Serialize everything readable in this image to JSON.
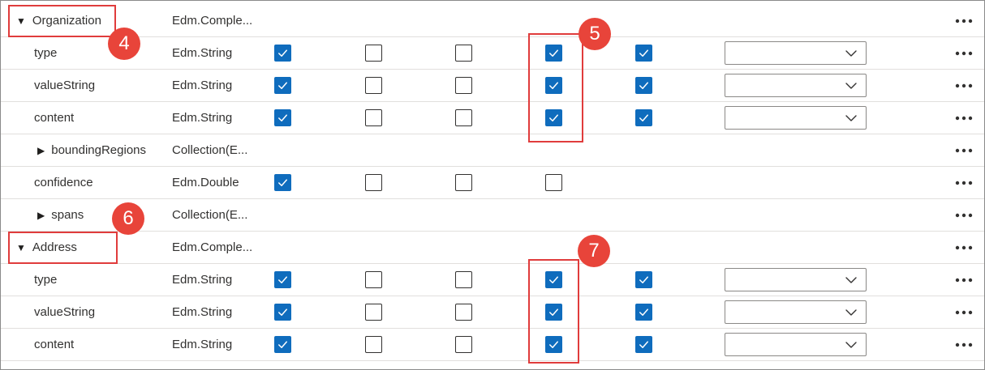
{
  "rows": [
    {
      "name": "Organization",
      "type": "Edm.Comple...",
      "kind": "expanded",
      "indent": 0,
      "checks": null,
      "dropdown": null
    },
    {
      "name": "type",
      "type": "Edm.String",
      "kind": "leaf",
      "indent": 1,
      "checks": [
        true,
        false,
        false,
        true,
        true
      ],
      "dropdown": ""
    },
    {
      "name": "valueString",
      "type": "Edm.String",
      "kind": "leaf",
      "indent": 1,
      "checks": [
        true,
        false,
        false,
        true,
        true
      ],
      "dropdown": ""
    },
    {
      "name": "content",
      "type": "Edm.String",
      "kind": "leaf",
      "indent": 1,
      "checks": [
        true,
        false,
        false,
        true,
        true
      ],
      "dropdown": ""
    },
    {
      "name": "boundingRegions",
      "type": "Collection(E...",
      "kind": "collapsed",
      "indent": 1,
      "checks": null,
      "dropdown": null
    },
    {
      "name": "confidence",
      "type": "Edm.Double",
      "kind": "leaf",
      "indent": 1,
      "checks": [
        true,
        false,
        false,
        false
      ],
      "dropdown": null
    },
    {
      "name": "spans",
      "type": "Collection(E...",
      "kind": "collapsed",
      "indent": 1,
      "checks": null,
      "dropdown": null
    },
    {
      "name": "Address",
      "type": "Edm.Comple...",
      "kind": "expanded",
      "indent": 0,
      "checks": null,
      "dropdown": null
    },
    {
      "name": "type",
      "type": "Edm.String",
      "kind": "leaf",
      "indent": 1,
      "checks": [
        true,
        false,
        false,
        true,
        true
      ],
      "dropdown": ""
    },
    {
      "name": "valueString",
      "type": "Edm.String",
      "kind": "leaf",
      "indent": 1,
      "checks": [
        true,
        false,
        false,
        true,
        true
      ],
      "dropdown": ""
    },
    {
      "name": "content",
      "type": "Edm.String",
      "kind": "leaf",
      "indent": 1,
      "checks": [
        true,
        false,
        false,
        true,
        true
      ],
      "dropdown": ""
    }
  ],
  "icons": {
    "expanded": "caret-down-icon",
    "collapsed": "caret-right-icon",
    "more": "more-horizontal-icon",
    "check": "checkmark-icon",
    "dropdown": "chevron-down-icon"
  },
  "annotations": {
    "badges": [
      "4",
      "5",
      "6",
      "7"
    ],
    "badge_color": "#e8443a",
    "box_color": "#e03c3c"
  },
  "colors": {
    "checked": "#0f6cbd",
    "border": "#e1dfdd",
    "text": "#323130"
  }
}
